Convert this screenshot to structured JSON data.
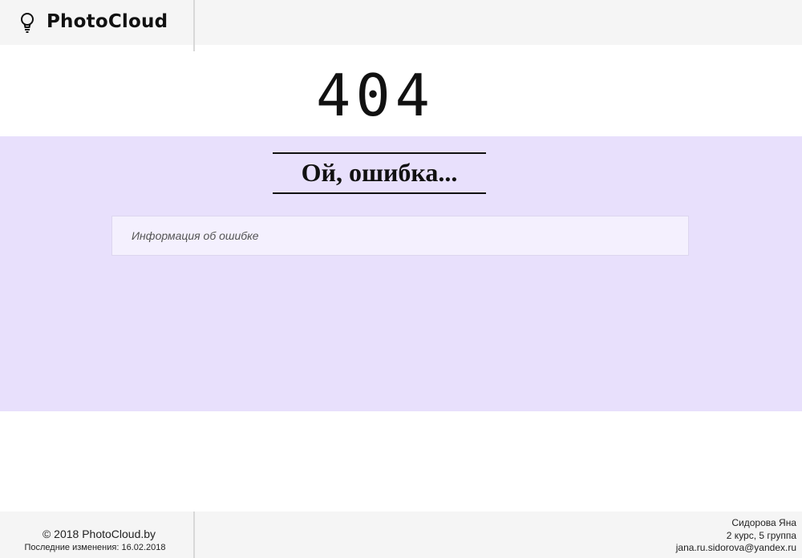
{
  "header": {
    "brand_icon": "lightbulb-icon",
    "brand_name": "PhotoCloud"
  },
  "error": {
    "code": "404",
    "title": "Ой, ошибка...",
    "info": "Информация об ошибке"
  },
  "footer": {
    "copyright": "© 2018 PhotoCloud.by",
    "last_change": "Последние изменения: 16.02.2018",
    "author_name": "Сидорова Яна",
    "author_group": "2 курс, 5 группа",
    "author_email": "jana.ru.sidorova@yandex.ru"
  },
  "colors": {
    "header_bg": "#f5f5f5",
    "error_band_bg": "#e8e0fc",
    "info_box_bg": "#f4f0fe"
  }
}
